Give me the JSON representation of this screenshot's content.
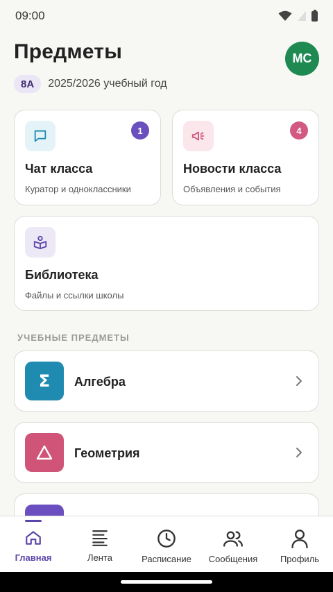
{
  "status": {
    "time": "09:00"
  },
  "header": {
    "title": "Предметы",
    "avatar_initials": "МС",
    "class_badge": "8А",
    "year": "2025/2026 учебный год"
  },
  "cards": {
    "chat": {
      "title": "Чат класса",
      "subtitle": "Куратор и одноклассники",
      "badge": "1",
      "icon": "chat-bubble-icon"
    },
    "news": {
      "title": "Новости класса",
      "subtitle": "Объявления и события",
      "badge": "4",
      "icon": "megaphone-icon"
    },
    "library": {
      "title": "Библиотека",
      "subtitle": "Файлы и ссылки школы",
      "icon": "book-reader-icon"
    }
  },
  "subjects_section": {
    "label": "УЧЕБНЫЕ ПРЕДМЕТЫ",
    "items": [
      {
        "name": "Алгебра",
        "icon": "sigma-icon",
        "color": "#1f8bb0"
      },
      {
        "name": "Геометрия",
        "icon": "triangle-icon",
        "color": "#cf5478"
      },
      {
        "name": "",
        "icon": "subject-icon",
        "color": "#6b4fc0"
      }
    ]
  },
  "nav": {
    "items": [
      {
        "label": "Главная",
        "icon": "home-icon",
        "active": true
      },
      {
        "label": "Лента",
        "icon": "feed-icon"
      },
      {
        "label": "Расписание",
        "icon": "clock-icon"
      },
      {
        "label": "Сообщения",
        "icon": "people-icon"
      },
      {
        "label": "Профиль",
        "icon": "person-icon"
      }
    ]
  },
  "colors": {
    "accent": "#5b45a8",
    "avatar": "#1e8a52",
    "chat_badge": "#6a4fbf",
    "news_badge": "#d25a82"
  }
}
